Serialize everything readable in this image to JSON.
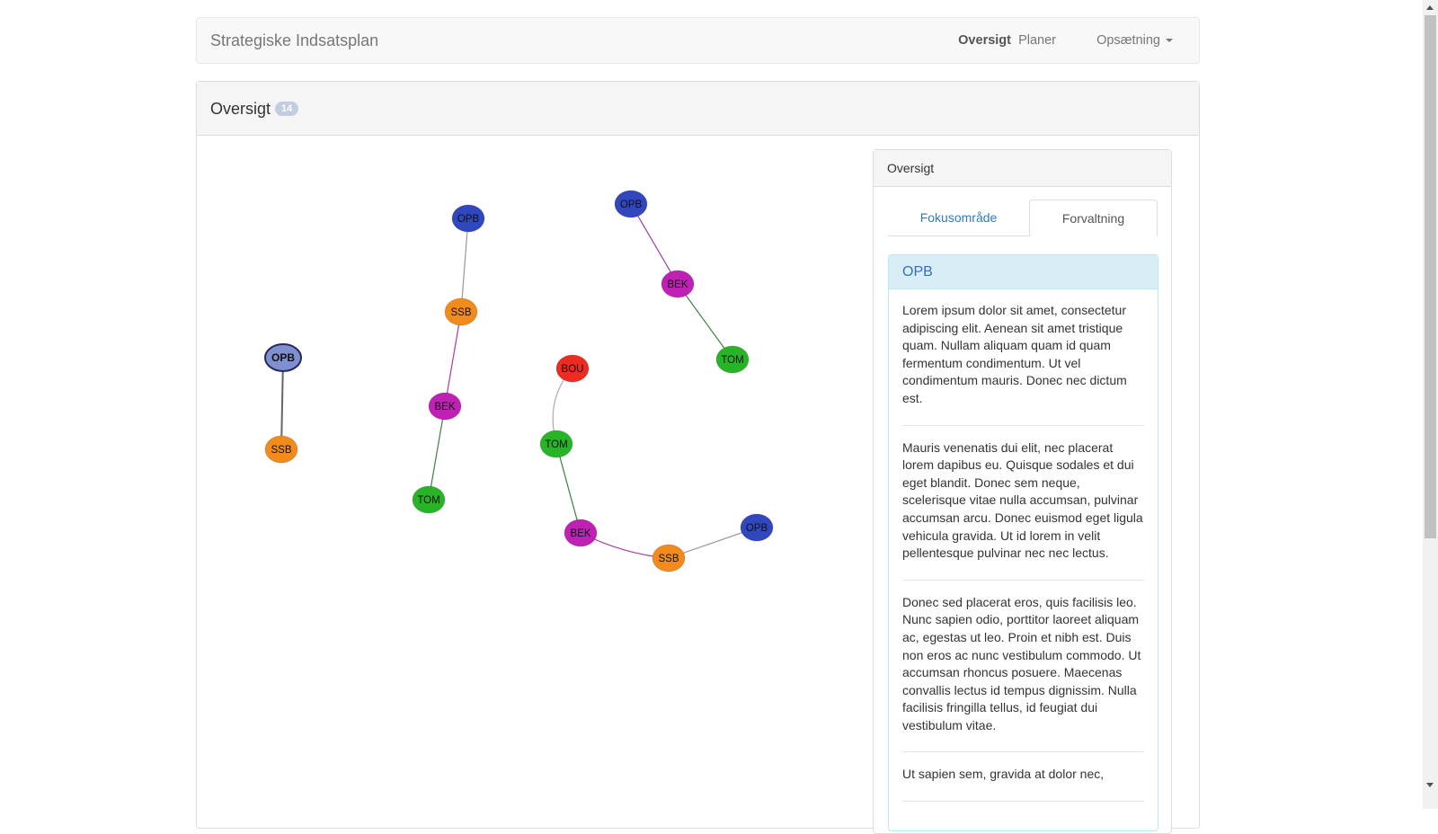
{
  "navbar": {
    "brand": "Strategiske Indsatsplan",
    "items": [
      {
        "label": "Oversigt",
        "active": true
      },
      {
        "label": "Planer",
        "active": false
      },
      {
        "label": "Opsætning",
        "active": false,
        "dropdown": true
      }
    ]
  },
  "main": {
    "title": "Oversigt",
    "badge": "14"
  },
  "graph": {
    "nodes": [
      {
        "id": "n1",
        "label": "OPB",
        "color": "#7f8fd0",
        "selected": true
      },
      {
        "id": "n2",
        "label": "SSB",
        "color": "#f08b1c"
      },
      {
        "id": "n3",
        "label": "OPB",
        "color": "#3047c0"
      },
      {
        "id": "n4",
        "label": "SSB",
        "color": "#f08b1c"
      },
      {
        "id": "n5",
        "label": "BEK",
        "color": "#c021b5"
      },
      {
        "id": "n6",
        "label": "TOM",
        "color": "#27b527"
      },
      {
        "id": "n7",
        "label": "OPB",
        "color": "#3047c0"
      },
      {
        "id": "n8",
        "label": "BEK",
        "color": "#c021b5"
      },
      {
        "id": "n9",
        "label": "TOM",
        "color": "#27b527"
      },
      {
        "id": "n10",
        "label": "BOU",
        "color": "#ee2b21"
      },
      {
        "id": "n11",
        "label": "TOM",
        "color": "#27b527"
      },
      {
        "id": "n12",
        "label": "BEK",
        "color": "#c021b5"
      },
      {
        "id": "n13",
        "label": "SSB",
        "color": "#f08b1c"
      },
      {
        "id": "n14",
        "label": "OPB",
        "color": "#3047c0"
      }
    ],
    "edges": [
      {
        "from": "n1",
        "to": "n2",
        "color": "#666666"
      },
      {
        "from": "n3",
        "to": "n4",
        "color": "#999999"
      },
      {
        "from": "n4",
        "to": "n5",
        "color": "#b03aa8"
      },
      {
        "from": "n5",
        "to": "n6",
        "color": "#3f7f3f"
      },
      {
        "from": "n7",
        "to": "n8",
        "color": "#a0399e"
      },
      {
        "from": "n8",
        "to": "n9",
        "color": "#3f7f3f"
      },
      {
        "from": "n10",
        "to": "n11",
        "color": "#aaaaaa",
        "curved": true
      },
      {
        "from": "n11",
        "to": "n12",
        "color": "#3f7f3f"
      },
      {
        "from": "n12",
        "to": "n13",
        "color": "#a0399e"
      },
      {
        "from": "n13",
        "to": "n14",
        "color": "#999999"
      }
    ]
  },
  "side_panel": {
    "title": "Oversigt",
    "tabs": [
      {
        "label": "Fokusområde",
        "active": false
      },
      {
        "label": "Forvaltning",
        "active": true
      }
    ],
    "info": {
      "heading": "OPB",
      "paragraphs": [
        "Lorem ipsum dolor sit amet, consectetur adipiscing elit. Aenean sit amet tristique quam. Nullam aliquam quam id quam fermentum condimentum. Ut vel condimentum mauris. Donec nec dictum est.",
        "Mauris venenatis dui elit, nec placerat lorem dapibus eu. Quisque sodales et dui eget blandit. Donec sem neque, scelerisque vitae nulla accumsan, pulvinar accumsan arcu. Donec euismod eget ligula vehicula gravida. Ut id lorem in velit pellentesque pulvinar nec nec lectus.",
        "Donec sed placerat eros, quis facilisis leo. Nunc sapien odio, porttitor laoreet aliquam ac, egestas ut leo. Proin et nibh est. Duis non eros ac nunc vestibulum commodo. Ut accumsan rhoncus posuere. Maecenas convallis lectus id tempus dignissim. Nulla facilisis fringilla tellus, id feugiat dui vestibulum vitae.",
        "Ut sapien sem, gravida at dolor nec,"
      ]
    }
  }
}
